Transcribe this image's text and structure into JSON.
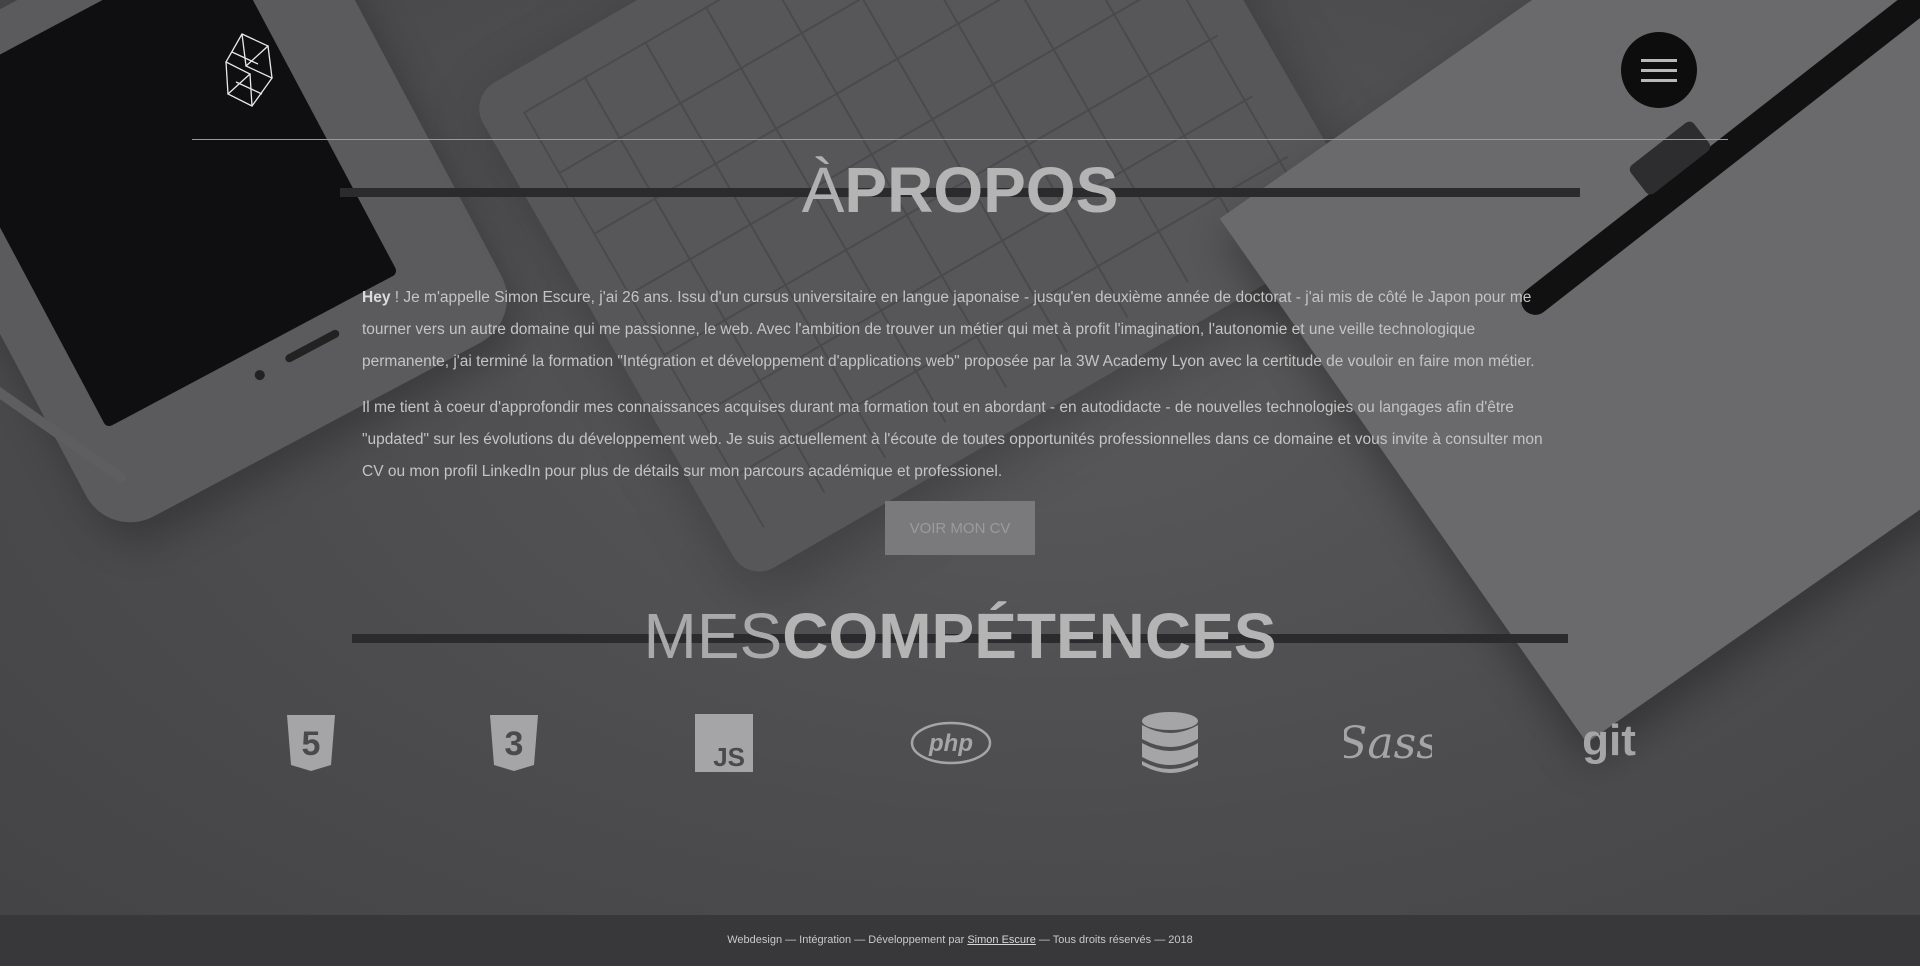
{
  "header": {
    "logo_alt": "S",
    "menu_icon": "hamburger-icon"
  },
  "about": {
    "title_light": "À",
    "title_bold": "PROPOS",
    "p1_bold": "Hey",
    "p1_rest": " ! Je m'appelle Simon Escure, j'ai 26 ans. Issu d'un cursus universitaire en langue japonaise - jusqu'en deuxième année de doctorat - j'ai mis de côté le Japon pour me tourner vers un autre domaine qui me passionne, le web. Avec l'ambition de trouver un métier qui met à profit l'imagination, l'autonomie et une veille technologique permanente, j'ai terminé la formation \"Intégration et développement d'applications web\" proposée par la 3W Academy Lyon avec la certitude de vouloir en faire mon métier.",
    "p2": "Il me tient à coeur d'approfondir mes connaissances acquises durant ma formation tout en abordant - en autodidacte - de nouvelles technologies ou langages afin d'être \"updated\" sur les évolutions du développement web. Je suis actuellement à l'écoute de toutes opportunités professionnelles dans ce domaine et vous invite à consulter mon CV ou mon profil LinkedIn pour plus de détails sur mon parcours académique et professionel.",
    "cv_button": "VOIR MON CV"
  },
  "skills": {
    "title_light": "MES",
    "title_bold": "COMPÉTENCES",
    "items": [
      {
        "icon": "html5-icon",
        "label": "5"
      },
      {
        "icon": "css3-icon",
        "label": "3"
      },
      {
        "icon": "javascript-icon",
        "label": "JS"
      },
      {
        "icon": "php-icon",
        "label": "php"
      },
      {
        "icon": "database-icon",
        "label": ""
      },
      {
        "icon": "sass-icon",
        "label": "Sass"
      },
      {
        "icon": "git-icon",
        "label": "git"
      }
    ]
  },
  "footer": {
    "before": "Webdesign — Intégration — Développement par ",
    "link": "Simon Escure",
    "after": " — Tous droits réservés — 2018"
  },
  "colors": {
    "overlay": "#4a4a4c",
    "footer_bg": "#38383a",
    "button_bg": "#7a7a7c",
    "menu_bg": "#0d0d0e"
  }
}
